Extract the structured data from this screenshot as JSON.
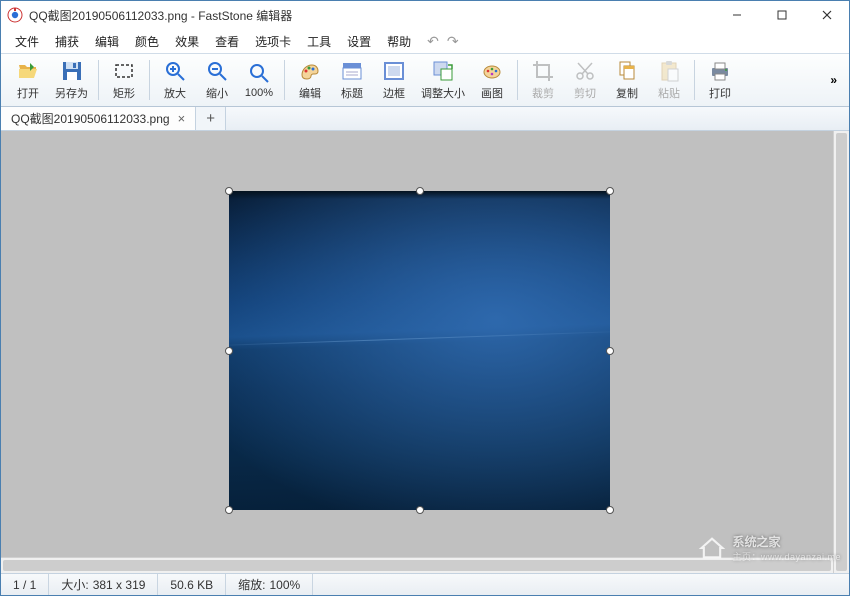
{
  "window": {
    "title": "QQ截图20190506112033.png - FastStone 编辑器"
  },
  "menu": {
    "items": [
      "文件",
      "捕获",
      "编辑",
      "颜色",
      "效果",
      "查看",
      "选项卡",
      "工具",
      "设置",
      "帮助"
    ]
  },
  "toolbar": {
    "open": "打开",
    "saveas": "另存为",
    "rect": "矩形",
    "zoomin": "放大",
    "zoomout": "缩小",
    "zoom100": "100%",
    "edit": "编辑",
    "caption": "标题",
    "border": "边框",
    "resize": "调整大小",
    "draw": "画图",
    "crop": "裁剪",
    "cut": "剪切",
    "copy": "复制",
    "paste": "粘贴",
    "print": "打印"
  },
  "tabs": {
    "active": "QQ截图20190506112033.png"
  },
  "status": {
    "page": "1 / 1",
    "size_label": "大小:",
    "size_value": "381 x 319",
    "filesize": "50.6 KB",
    "zoom_label": "缩放:",
    "zoom_value": "100%"
  },
  "watermark": {
    "brand": "系统之家",
    "url": "主页：www.dayanzai.me"
  }
}
